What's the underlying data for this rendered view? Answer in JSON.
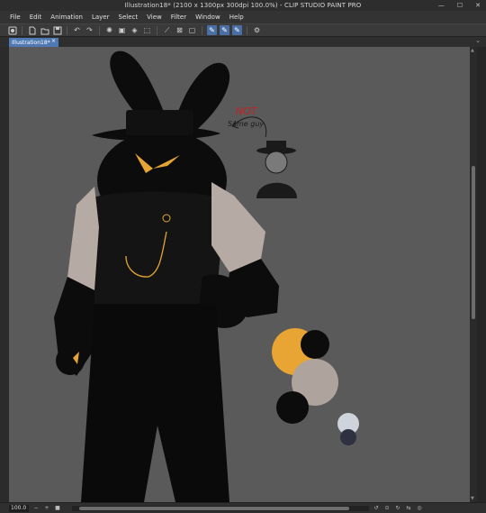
{
  "window": {
    "title": "Illustration18* (2100 x 1300px 300dpi 100.0%)  - CLIP STUDIO PAINT PRO",
    "minimize": "—",
    "maximize": "☐",
    "close": "✕"
  },
  "menu": {
    "items": [
      "File",
      "Edit",
      "Animation",
      "Layer",
      "Select",
      "View",
      "Filter",
      "Window",
      "Help"
    ]
  },
  "toolbar": {
    "icons": [
      "app-icon",
      "new-file-icon",
      "open-file-icon",
      "save-file-icon",
      "undo-icon",
      "redo-icon",
      "loading-icon",
      "clear-icon",
      "fill-icon",
      "transform-icon",
      "ruler-icon",
      "snap-icon",
      "pen-stabilize-icon",
      "pen-a-icon",
      "pen-b-icon",
      "pen-c-icon",
      "settings-icon"
    ]
  },
  "tabs": [
    {
      "label": "Illustration18*",
      "close": "×"
    }
  ],
  "collapse_glyph": "⌄",
  "canvas": {
    "annotation_not": "NOT",
    "annotation_same": "Same guy",
    "colors": {
      "background": "#5a5a5a",
      "black": "#0c0c0c",
      "sleeve": "#b6aaa4",
      "gold": "#e5a533",
      "red_text": "#c8201f",
      "palette_orange": "#e8a533",
      "palette_beige": "#aea39d",
      "palette_light": "#cfd3dc",
      "palette_navy": "#2e3140"
    }
  },
  "status": {
    "zoom": "100.0",
    "icons": [
      "zoom-down-icon",
      "zoom-up-icon",
      "fit-icon",
      "rotate-left-icon",
      "rotate-reset-icon",
      "rotate-right-icon",
      "flip-icon",
      "navigator-icon"
    ]
  }
}
